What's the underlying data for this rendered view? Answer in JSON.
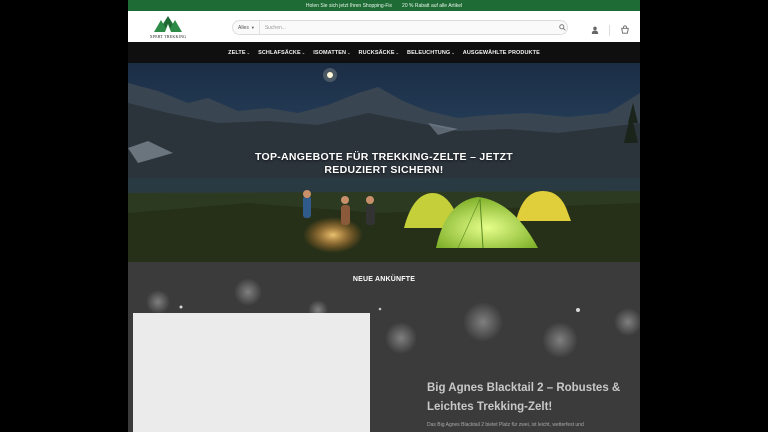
{
  "topbar": {
    "promo_left": "Holen Sie sich jetzt Ihren Shopping-Fix",
    "promo_right": "20 % Rabatt auf alle Artikel"
  },
  "brand": {
    "name": "XPERT TREKKING",
    "color": "#1e6b35"
  },
  "search": {
    "category": "Alles",
    "placeholder": "Suchen..."
  },
  "nav": {
    "items": [
      {
        "label": "ZELTE"
      },
      {
        "label": "SCHLAFSÄCKE"
      },
      {
        "label": "ISOMATTEN"
      },
      {
        "label": "RUCKSÄCKE"
      },
      {
        "label": "BELEUCHTUNG"
      },
      {
        "label": "AUSGEWÄHLTE PRODUKTE"
      }
    ]
  },
  "hero": {
    "title_line1": "TOP-ANGEBOTE FÜR TREKKING-ZELTE – JETZT",
    "title_line2": "REDUZIERT SICHERN!"
  },
  "arrivals": {
    "heading": "NEUE ANKÜNFTE",
    "product_title_line1": "Big Agnes Blacktail 2 – Robustes &",
    "product_title_line2": "Leichtes Trekking-Zelt!",
    "product_desc": "Das Big Agnes Blacktail 2 bietet Platz für zwei, ist leicht, wetterfest und"
  },
  "icons": {
    "user": "user-icon",
    "cart": "cart-icon",
    "search": "search-icon"
  }
}
